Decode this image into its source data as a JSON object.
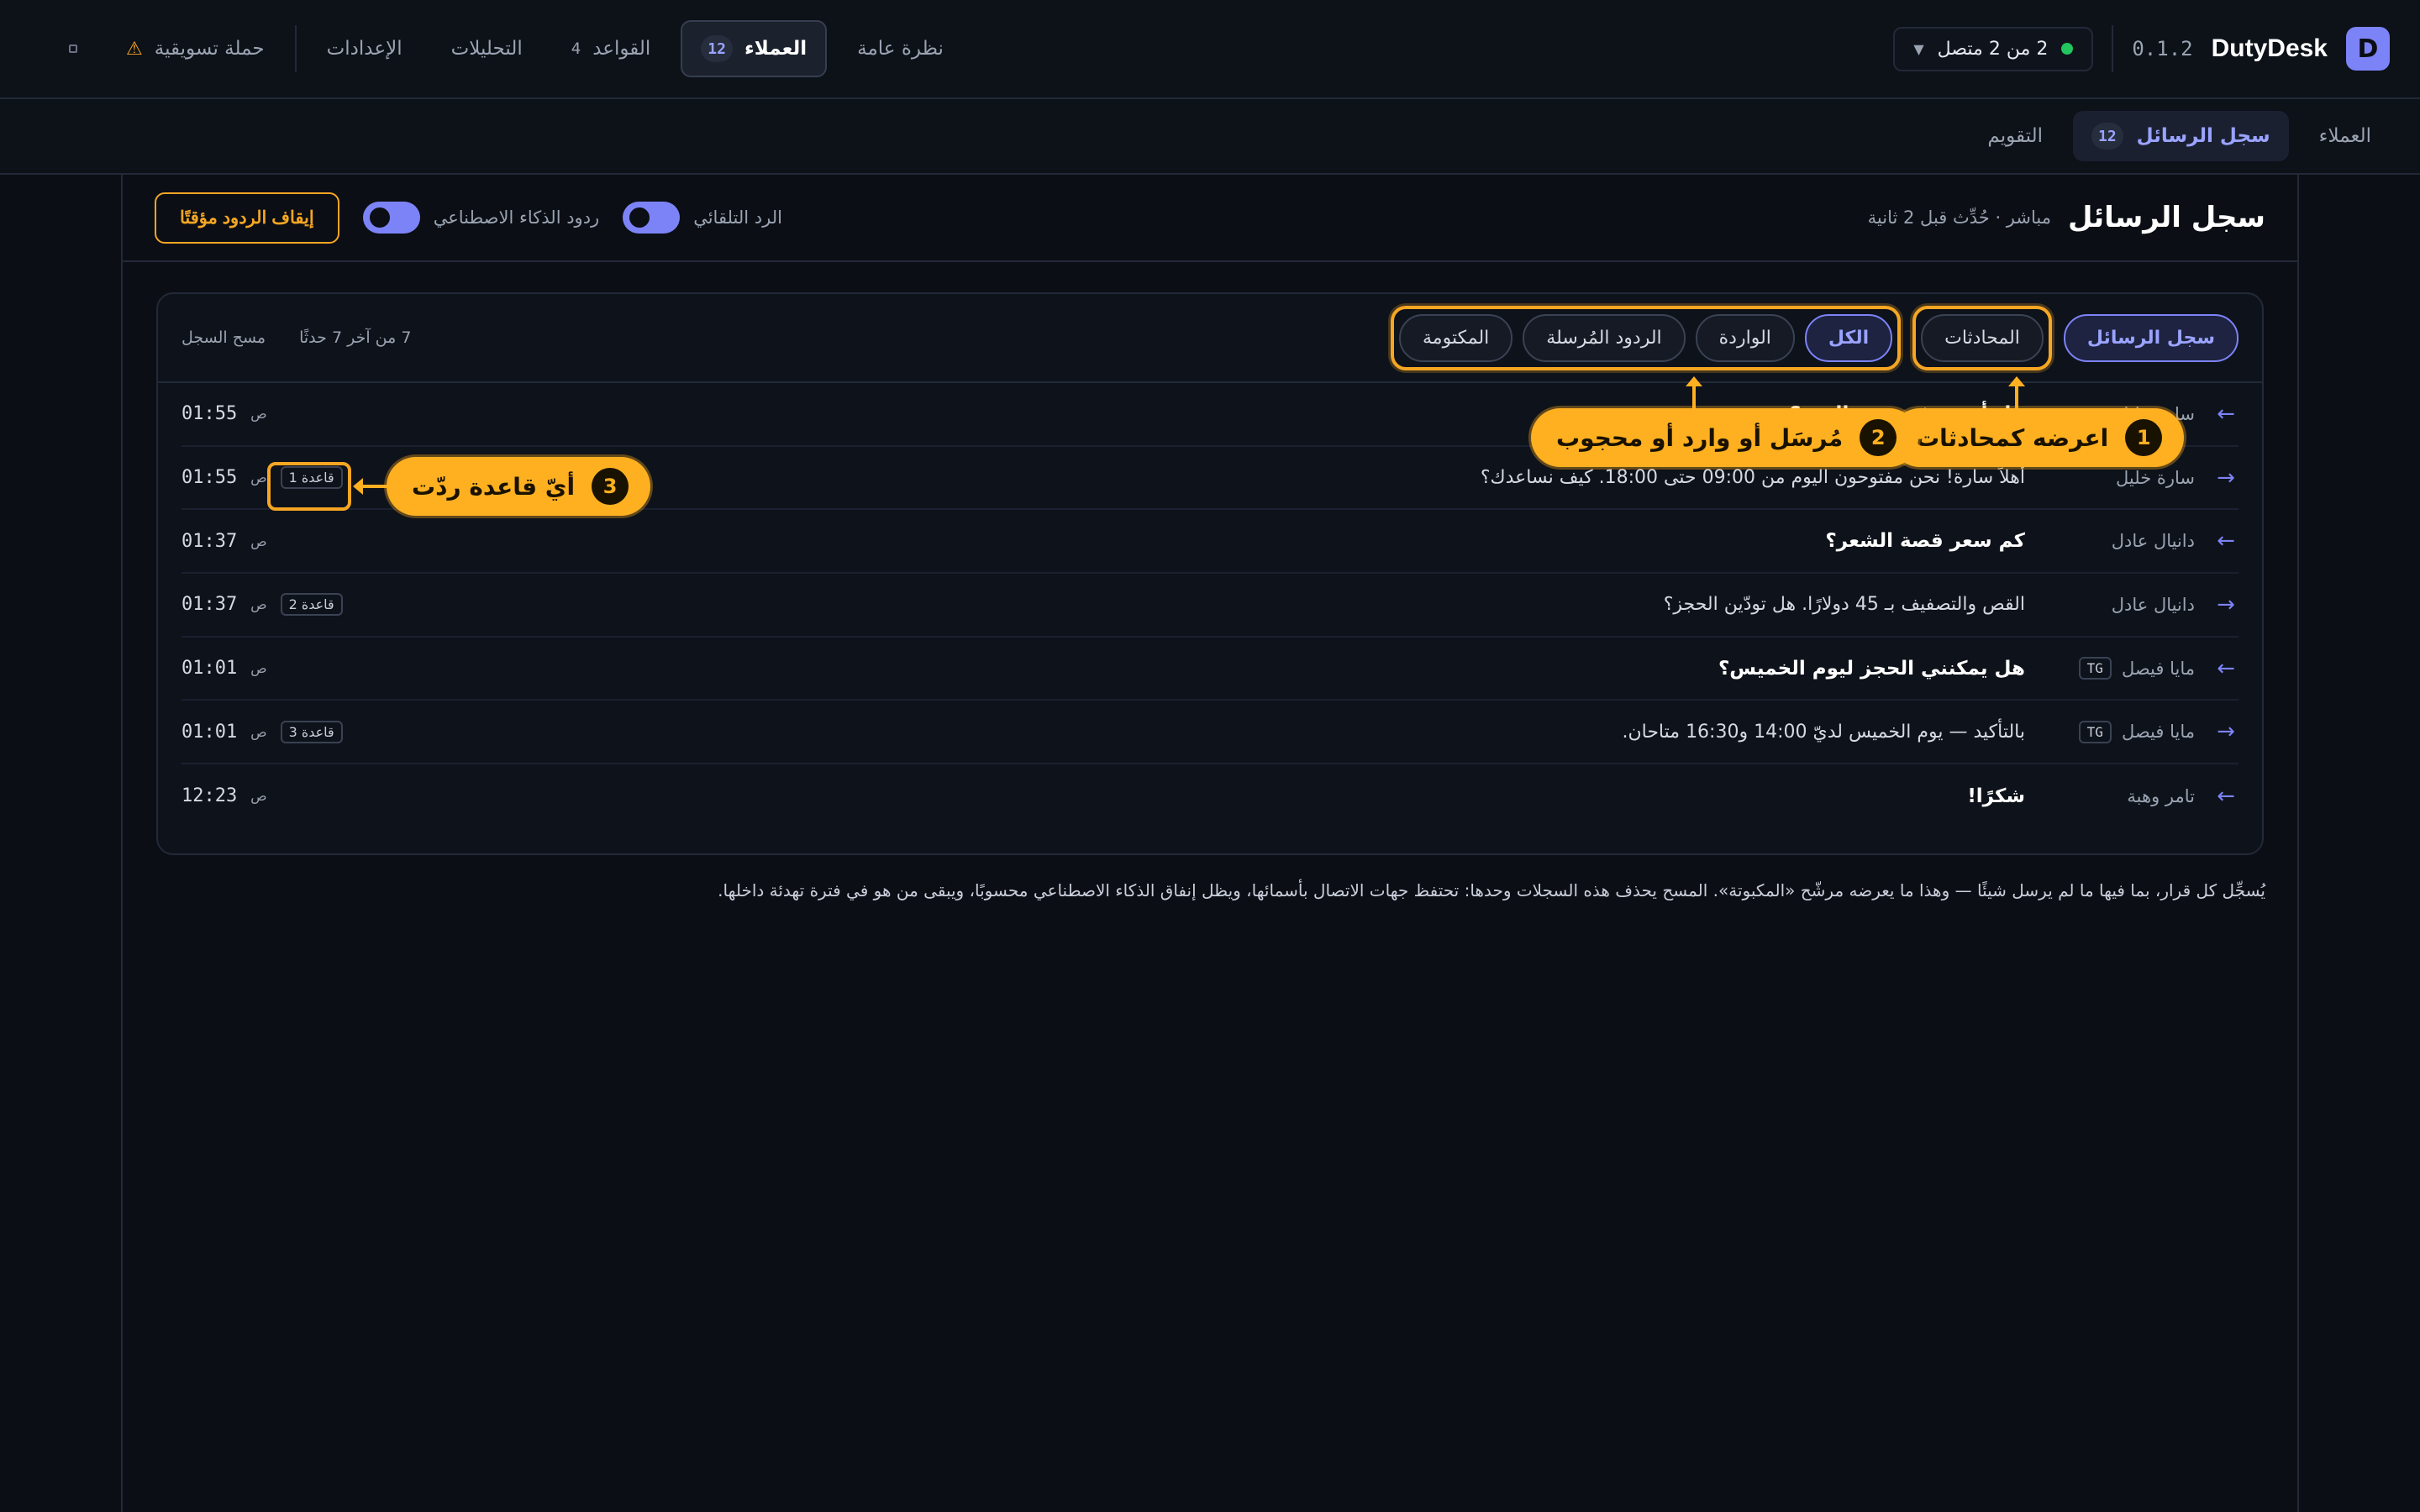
{
  "app": {
    "name": "DutyDesk",
    "version": "0.1.2",
    "logo_letter": "D"
  },
  "connection": {
    "label": "2 من 2 متصل",
    "status_color": "#22c55e"
  },
  "nav": {
    "items": [
      {
        "label": "نظرة عامة",
        "count": ""
      },
      {
        "label": "العملاء",
        "count": "12",
        "active": true
      },
      {
        "label": "القواعد",
        "count": "4"
      },
      {
        "label": "التحليلات",
        "count": ""
      },
      {
        "label": "الإعدادات",
        "count": ""
      },
      {
        "label": "حملة تسويقية",
        "count": ""
      }
    ]
  },
  "subnav": {
    "items": [
      {
        "label": "العملاء"
      },
      {
        "label": "سجل الرسائل",
        "count": "12",
        "active": true
      },
      {
        "label": "التقويم"
      }
    ]
  },
  "header": {
    "title": "سجل الرسائل",
    "live": "مباشر · حُدِّث قبل 2 ثانية",
    "auto_reply_label": "الرد التلقائي",
    "ai_reply_label": "ردود الذكاء الاصطناعي",
    "pause_label": "إيقاف الردود مؤقتًا"
  },
  "card": {
    "view_tabs": [
      "سجل الرسائل",
      "المحادثات"
    ],
    "filter_tabs": [
      "الكل",
      "الواردة",
      "الردود المُرسلة",
      "المكتومة"
    ],
    "count_text": "7 من آخر 7 حدثًا",
    "clear_label": "مسح السجل"
  },
  "rows": [
    {
      "dir": "in",
      "sender": "سارة خليل",
      "tg": "",
      "text": "هل أنتم مفتوحون اليوم؟",
      "time": "01:55",
      "ampm": "ص",
      "rule": ""
    },
    {
      "dir": "out",
      "sender": "سارة خليل",
      "tg": "",
      "text": "أهلاً سارة! نحن مفتوحون اليوم من 09:00 حتى 18:00. كيف نساعدك؟",
      "time": "01:55",
      "ampm": "ص",
      "rule": "قاعدة 1"
    },
    {
      "dir": "in",
      "sender": "دانيال عادل",
      "tg": "",
      "text": "كم سعر قصة الشعر؟",
      "time": "01:37",
      "ampm": "ص",
      "rule": ""
    },
    {
      "dir": "out",
      "sender": "دانيال عادل",
      "tg": "",
      "text": "القص والتصفيف بـ 45 دولارًا. هل تودّين الحجز؟",
      "time": "01:37",
      "ampm": "ص",
      "rule": "قاعدة 2"
    },
    {
      "dir": "in",
      "sender": "مايا فيصل",
      "tg": "TG",
      "text": "هل يمكنني الحجز ليوم الخميس؟",
      "time": "01:01",
      "ampm": "ص",
      "rule": ""
    },
    {
      "dir": "out",
      "sender": "مايا فيصل",
      "tg": "TG",
      "text": "بالتأكيد — يوم الخميس لديّ 14:00 و16:30 متاحان.",
      "time": "01:01",
      "ampm": "ص",
      "rule": "قاعدة 3"
    },
    {
      "dir": "in",
      "sender": "تامر وهبة",
      "tg": "",
      "text": "شكرًا!",
      "time": "12:23",
      "ampm": "ص",
      "rule": ""
    }
  ],
  "footnote": "يُسجِّل كل قرار، بما فيها ما لم يرسل شيئًا — وهذا ما يعرضه مرشّح «المكبوتة». المسح يحذف هذه السجلات وحدها: تحتفظ جهات الاتصال بأسمائها، ويظل إنفاق الذكاء الاصطناعي محسوبًا، ويبقى من هو في فترة تهدئة داخلها.",
  "callouts": [
    {
      "num": "1",
      "text": "اعرضه كمحادثات"
    },
    {
      "num": "2",
      "text": "مُرسَل أو وارد أو محجوب"
    },
    {
      "num": "3",
      "text": "أيّ قاعدة ردّت"
    }
  ],
  "colors": {
    "accent": "#7c83f7",
    "highlight": "#f5a623",
    "online": "#22c55e"
  }
}
